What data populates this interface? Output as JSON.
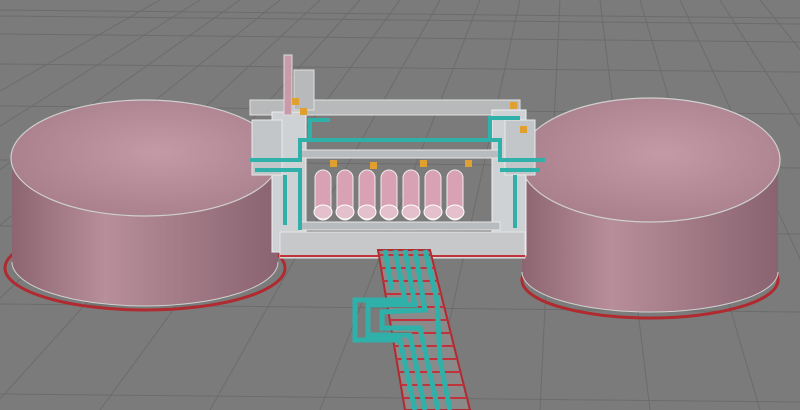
{
  "viewport": {
    "background": "#7b7b7b",
    "grid_color": "#6a6a6a",
    "grid_visible": true
  },
  "scene": {
    "tank_color": "#b48a96",
    "tank_shade": "#9a707e",
    "ring_color": "#c0333a",
    "pipe_color": "#2fb0a8",
    "vessel_color": "#d9a2b4",
    "structure_color": "#d3d6d8",
    "valve_color": "#e0a030",
    "objects": [
      {
        "name": "left-storage-tank",
        "icon": "cylinder-tank"
      },
      {
        "name": "right-storage-tank",
        "icon": "cylinder-tank"
      },
      {
        "name": "process-module",
        "icon": "pipe-rack"
      },
      {
        "name": "pressure-vessels",
        "icon": "vessel"
      },
      {
        "name": "pipeline-corridor",
        "icon": "pipe-bundle"
      }
    ]
  }
}
